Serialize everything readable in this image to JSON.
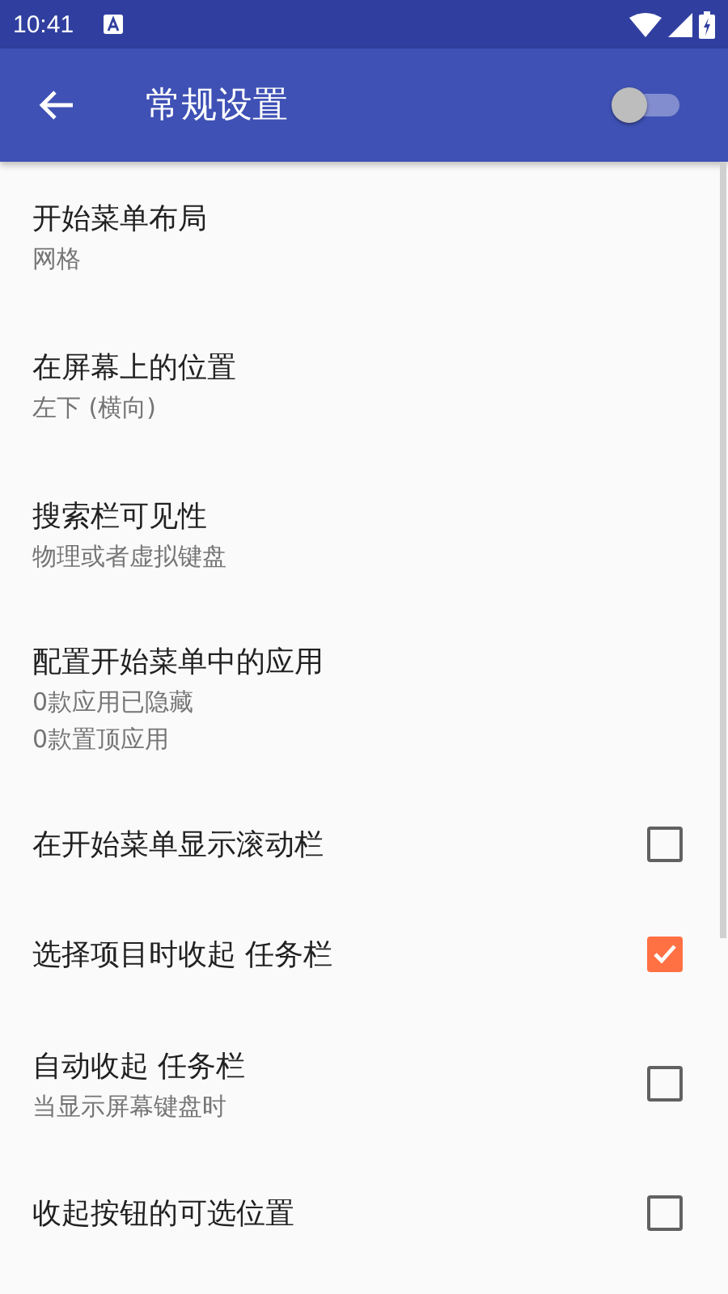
{
  "status_bar": {
    "time": "10:41"
  },
  "app_bar": {
    "title": "常规设置",
    "switch_on": false
  },
  "items": [
    {
      "kind": "text",
      "title": "开始菜单布局",
      "summaries": [
        "网格"
      ]
    },
    {
      "kind": "text",
      "title": "在屏幕上的位置",
      "summaries": [
        "左下 (横向)"
      ]
    },
    {
      "kind": "text",
      "title": "搜索栏可见性",
      "summaries": [
        "物理或者虚拟键盘"
      ]
    },
    {
      "kind": "text",
      "title": "配置开始菜单中的应用",
      "summaries": [
        "0款应用已隐藏",
        "0款置顶应用"
      ]
    },
    {
      "kind": "checkbox",
      "title": "在开始菜单显示滚动栏",
      "checked": false
    },
    {
      "kind": "checkbox",
      "title": "选择项目时收起 任务栏",
      "checked": true
    },
    {
      "kind": "checkbox",
      "title": "自动收起 任务栏",
      "summaries": [
        "当显示屏幕键盘时"
      ],
      "checked": false
    },
    {
      "kind": "checkbox",
      "title": "收起按钮的可选位置",
      "checked": false
    }
  ]
}
